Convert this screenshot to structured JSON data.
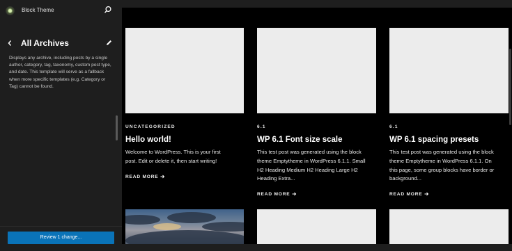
{
  "site": {
    "title": "Block Theme"
  },
  "panel": {
    "title": "All Archives",
    "description": "Displays any archive, including posts by a single author, category, tag, taxonomy, custom post type, and date. This template will serve as a fallback when more specific templates (e.g. Category or Tag) cannot be found."
  },
  "review_button": "Review 1 change...",
  "posts": [
    {
      "category": "UNCATEGORIZED",
      "title": "Hello world!",
      "excerpt": [
        "Welcome to WordPress. This is your first",
        "post. Edit or delete it, then start writing!"
      ],
      "read_more": "READ MORE"
    },
    {
      "category": "6.1",
      "title": "WP 6.1 Font size scale",
      "excerpt": [
        "This test post was generated using the block",
        "theme Emptytheme in WordPress 6.1.1. Small",
        "H2 Heading Medium H2 Heading Large H2",
        "Heading Extra..."
      ],
      "read_more": "READ MORE"
    },
    {
      "category": "6.1",
      "title": "WP 6.1 spacing presets",
      "excerpt": [
        "This test post was generated using the block",
        "theme Emptytheme in WordPress 6.1.1. On",
        "this page, some group blocks have border or",
        "background..."
      ],
      "read_more": "READ MORE"
    }
  ],
  "colors": {
    "sidebar_bg": "#1e1e1e",
    "canvas_bg": "#000000",
    "accent": "#0a73b8",
    "placeholder": "#ececec"
  },
  "icons": [
    "site-icon",
    "search-icon",
    "chevron-left-icon",
    "pencil-icon",
    "arrow-right-icon"
  ]
}
